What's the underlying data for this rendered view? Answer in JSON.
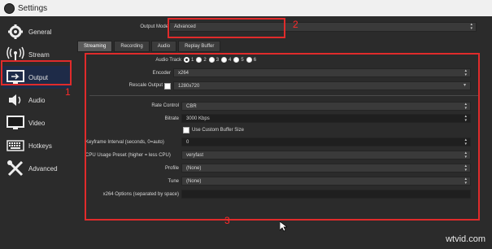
{
  "window": {
    "title": "Settings"
  },
  "sidebar": {
    "items": [
      {
        "label": "General",
        "icon": "gear-icon"
      },
      {
        "label": "Stream",
        "icon": "broadcast-icon"
      },
      {
        "label": "Output",
        "icon": "monitor-output-icon",
        "selected": true
      },
      {
        "label": "Audio",
        "icon": "speaker-icon"
      },
      {
        "label": "Video",
        "icon": "display-icon"
      },
      {
        "label": "Hotkeys",
        "icon": "keyboard-icon"
      },
      {
        "label": "Advanced",
        "icon": "tools-icon"
      }
    ]
  },
  "output_mode": {
    "label": "Output Mode",
    "value": "Advanced"
  },
  "tabs": [
    "Streaming",
    "Recording",
    "Audio",
    "Replay Buffer"
  ],
  "streaming": {
    "audio_track_label": "Audio Track",
    "audio_tracks": [
      "1",
      "2",
      "3",
      "4",
      "5",
      "6"
    ],
    "encoder_label": "Encoder",
    "encoder_value": "x264",
    "rescale_label": "Rescale Output",
    "rescale_value": "1280x720",
    "rate_control_label": "Rate Control",
    "rate_control_value": "CBR",
    "bitrate_label": "Bitrate",
    "bitrate_value": "3000 Kbps",
    "custom_buffer_label": "Use Custom Buffer Size",
    "keyframe_label": "Keyframe Interval (seconds, 0=auto)",
    "keyframe_value": "0",
    "preset_label": "CPU Usage Preset (higher = less CPU)",
    "preset_value": "veryfast",
    "profile_label": "Profile",
    "profile_value": "(None)",
    "tune_label": "Tune",
    "tune_value": "(None)",
    "x264_options_label": "x264 Options (separated by space)",
    "x264_options_value": ""
  },
  "annotations": {
    "one": "1",
    "two": "2",
    "three": "3"
  },
  "watermark": "wtvid.com",
  "colors": {
    "highlight": "#e02b2b",
    "selected_bg": "#1e2b48",
    "background": "#2b2b2b"
  }
}
